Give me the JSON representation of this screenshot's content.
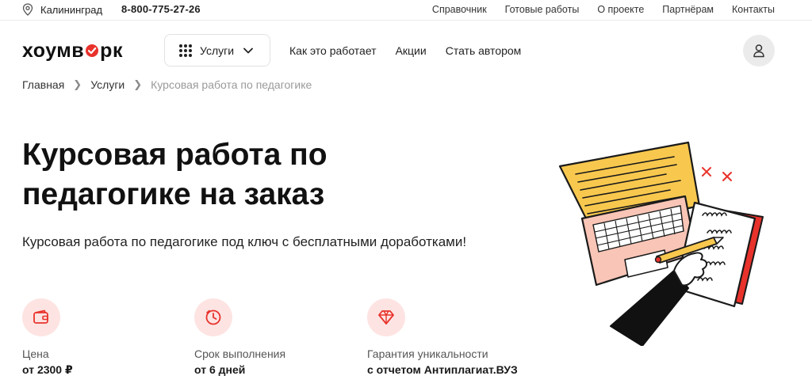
{
  "topbar": {
    "city": "Калининград",
    "phone": "8-800-775-27-26",
    "links": [
      "Справочник",
      "Готовые работы",
      "О проекте",
      "Партнёрам",
      "Контакты"
    ]
  },
  "header": {
    "logo_left": "хоумв",
    "logo_right": "рк",
    "services_label": "Услуги",
    "nav": [
      "Как это работает",
      "Акции",
      "Стать автором"
    ]
  },
  "breadcrumb": {
    "home": "Главная",
    "section": "Услуги",
    "current": "Курсовая работа по педагогике"
  },
  "hero": {
    "title": "Курсовая работа по педагогике на заказ",
    "subtitle": "Курсовая работа по педагогике под ключ с бесплатными доработками!"
  },
  "features": [
    {
      "label": "Цена",
      "value": "от 2300 ₽",
      "icon": "wallet-icon"
    },
    {
      "label": "Срок выполнения",
      "value": "от 6 дней",
      "icon": "clock-icon"
    },
    {
      "label": "Гарантия уникальности",
      "value": "с отчетом Антиплагиат.ВУЗ",
      "icon": "diamond-icon"
    }
  ],
  "colors": {
    "brand_red": "#e8322b",
    "icon_bg": "#fde4e2",
    "illus_yellow": "#f8c84e",
    "illus_pink": "#f9c5b6"
  }
}
